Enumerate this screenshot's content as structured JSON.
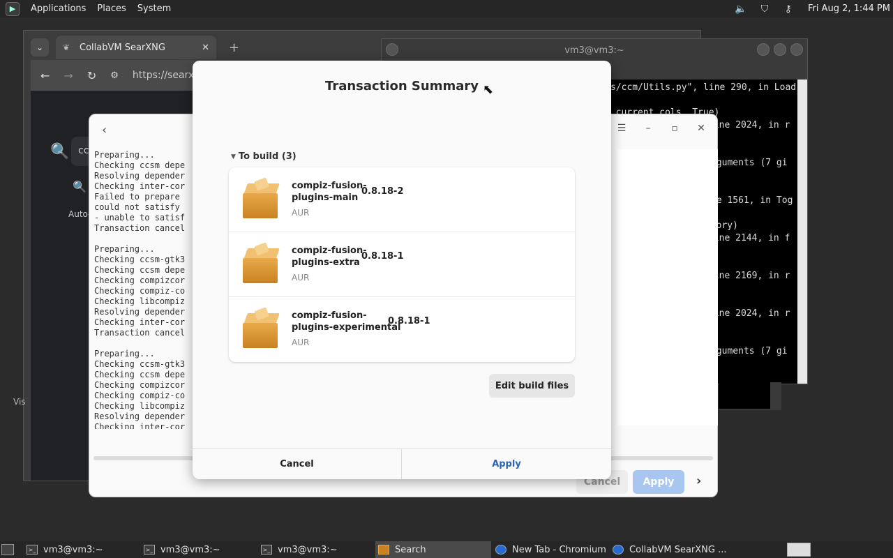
{
  "top_panel": {
    "menu": [
      "Applications",
      "Places",
      "System"
    ],
    "clock": "Fri Aug  2,  1:44 PM"
  },
  "browser": {
    "tab_title": "CollabVM SearXNG",
    "url": "https://searx",
    "search_text": "cc",
    "auto_text": "Auto-",
    "vis_text": "Vis"
  },
  "terminal": {
    "title": "vm3@vm3:~",
    "lines": [
      "s/ccm/Utils.py\", line 290, in Load",
      "  current cols, True)",
      "line 2024, in r",
      "",
      "rguments (7 gi",
      "",
      "ne 1561, in Tog",
      "",
      "egory)",
      "line 2144, in f",
      "",
      "line 2169, in r",
      "",
      "line 2024, in r",
      "",
      "rguments (7 gi"
    ]
  },
  "installer": {
    "log": "Preparing...\nChecking ccsm depe\nResolving depender\nChecking inter-cor\nFailed to prepare\ncould not satisfy\n- unable to satisf\nTransaction cancel\n\nPreparing...\nChecking ccsm-gtk3\nChecking ccsm depe\nChecking compizcor\nChecking compiz-co\nChecking libcompiz\nResolving depender\nChecking inter-cor\nTransaction cancel\n\nPreparing...\nChecking ccsm-gtk3\nChecking ccsm depe\nChecking compizcor\nChecking compiz-co\nChecking libcompiz\nResolving depender\nChecking inter-cor",
    "cancel": "Cancel",
    "apply": "Apply"
  },
  "dialog": {
    "title": "Transaction Summary",
    "section": "To build (3)",
    "packages": [
      {
        "name_line1": "compiz-fusion-",
        "name_line2": "plugins-main",
        "version": "0.8.18-2",
        "repo": "AUR"
      },
      {
        "name_line1": "compiz-fusion-",
        "name_line2": "plugins-extra",
        "version": "0.8.18-1",
        "repo": "AUR"
      },
      {
        "name_line1": "compiz-fusion-",
        "name_line2": "plugins-experimental",
        "version": "0.8.18-1",
        "repo": "AUR"
      }
    ],
    "edit_build_files": "Edit build files",
    "cancel": "Cancel",
    "apply": "Apply"
  },
  "taskbar": {
    "items": [
      "vm3@vm3:~",
      "vm3@vm3:~",
      "vm3@vm3:~",
      "Search",
      "New Tab - Chromium",
      "CollabVM SearXNG ..."
    ]
  }
}
